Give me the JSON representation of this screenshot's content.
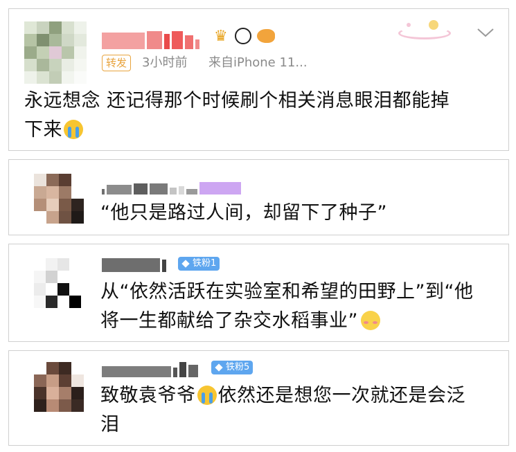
{
  "post": {
    "repost_tag": "转发",
    "time": "3小时前",
    "source": "来自iPhone 11...",
    "text_line1": "永远想念 还记得那个时候刷个相关消息眼泪都能掉",
    "text_line2": "下来",
    "emoji": "cry",
    "icons": [
      "crown-icon",
      "panda-icon",
      "fish-icon"
    ],
    "menu_icon": "chevron-down-icon"
  },
  "comments": [
    {
      "text": "“他只是路过人间，却留下了种子”"
    },
    {
      "badge": "铁粉1",
      "text_line1": "从“依然活跃在实验室和希望的田野上”到“他",
      "text_line2": "将一生都献给了杂交水稻事业”",
      "emoji": "flushed"
    },
    {
      "badge": "铁粉5",
      "text_pre": "致敬袁爷爷",
      "text_post": "依然还是想您一次就还是会泛",
      "text_line2": "泪",
      "emoji": "cry"
    }
  ],
  "colors": {
    "repost_tag": "#e8a33d",
    "meta": "#8a8a8a",
    "badge": "#5ea6ef",
    "border": "#cfcfcf"
  }
}
